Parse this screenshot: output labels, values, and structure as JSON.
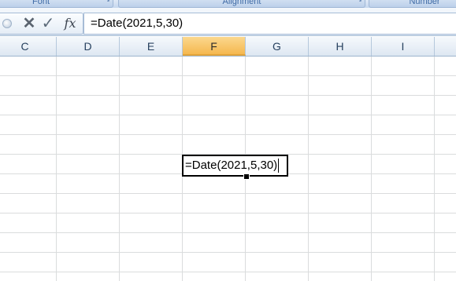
{
  "ribbon": {
    "groups": [
      "Font",
      "Alignment",
      "Number"
    ]
  },
  "formula_bar": {
    "buttons": {
      "cancel": "✕",
      "enter": "✓",
      "insert_function": "fx"
    },
    "value": "=Date(2021,5,30)"
  },
  "columns": [
    "C",
    "D",
    "E",
    "F",
    "G",
    "H",
    "I"
  ],
  "selected_column": "F",
  "active_cell": {
    "column": "F",
    "value": "=Date(2021,5,30)",
    "mode": "edit"
  },
  "colors": {
    "selected_header": "#f5b84f",
    "gridline": "#dadcdd",
    "header_text": "#27415f"
  }
}
